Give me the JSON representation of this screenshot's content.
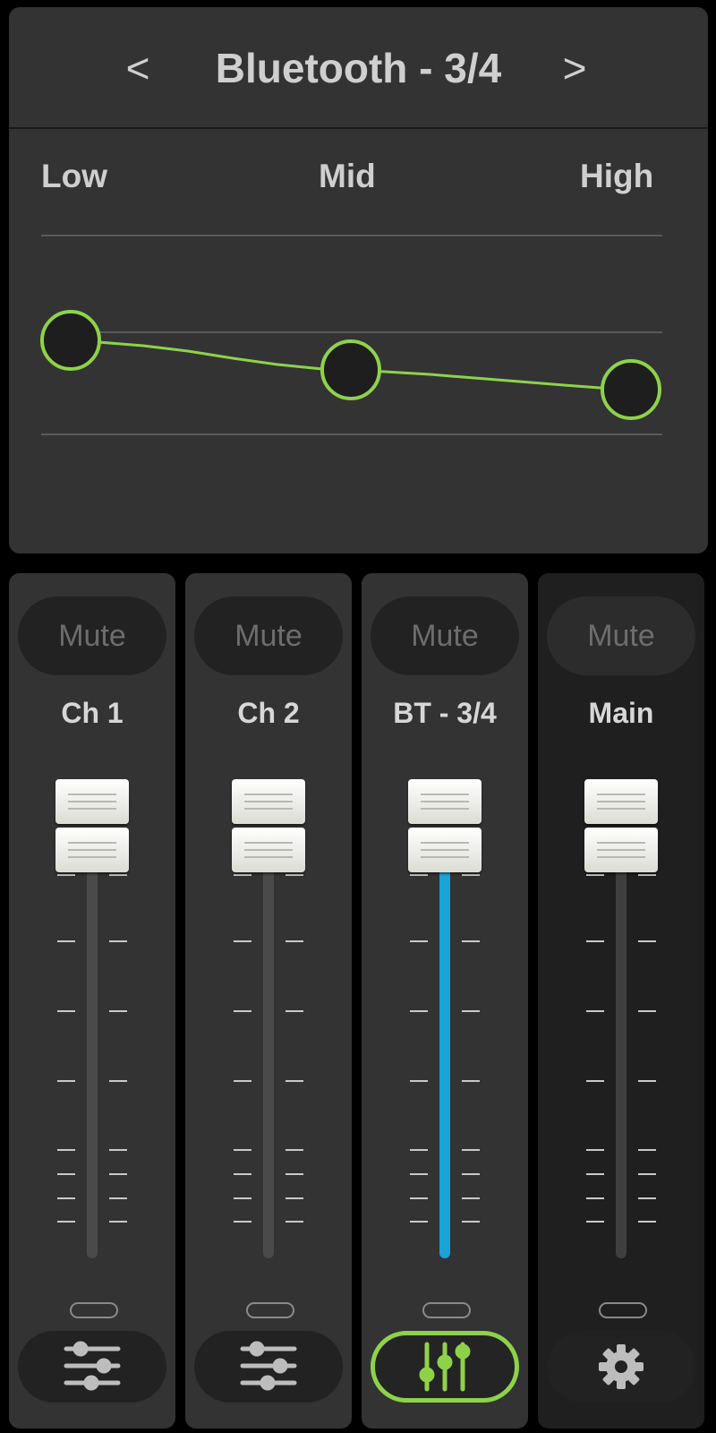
{
  "eq": {
    "prev_label": "<",
    "next_label": ">",
    "title": "Bluetooth - 3/4",
    "bands": [
      {
        "label": "Low"
      },
      {
        "label": "Mid"
      },
      {
        "label": "High"
      }
    ],
    "accent_color": "#8ed24a"
  },
  "channels": [
    {
      "mute_label": "Mute",
      "name": "Ch 1",
      "bottom_icon": "eq-sliders-icon",
      "active": false
    },
    {
      "mute_label": "Mute",
      "name": "Ch 2",
      "bottom_icon": "eq-sliders-icon",
      "active": false
    },
    {
      "mute_label": "Mute",
      "name": "BT - 3/4",
      "bottom_icon": "vertical-sliders-icon",
      "active": true,
      "meter_color": "#1aa3d8"
    },
    {
      "mute_label": "Mute",
      "name": "Main",
      "bottom_icon": "gear-icon",
      "active": false
    }
  ]
}
